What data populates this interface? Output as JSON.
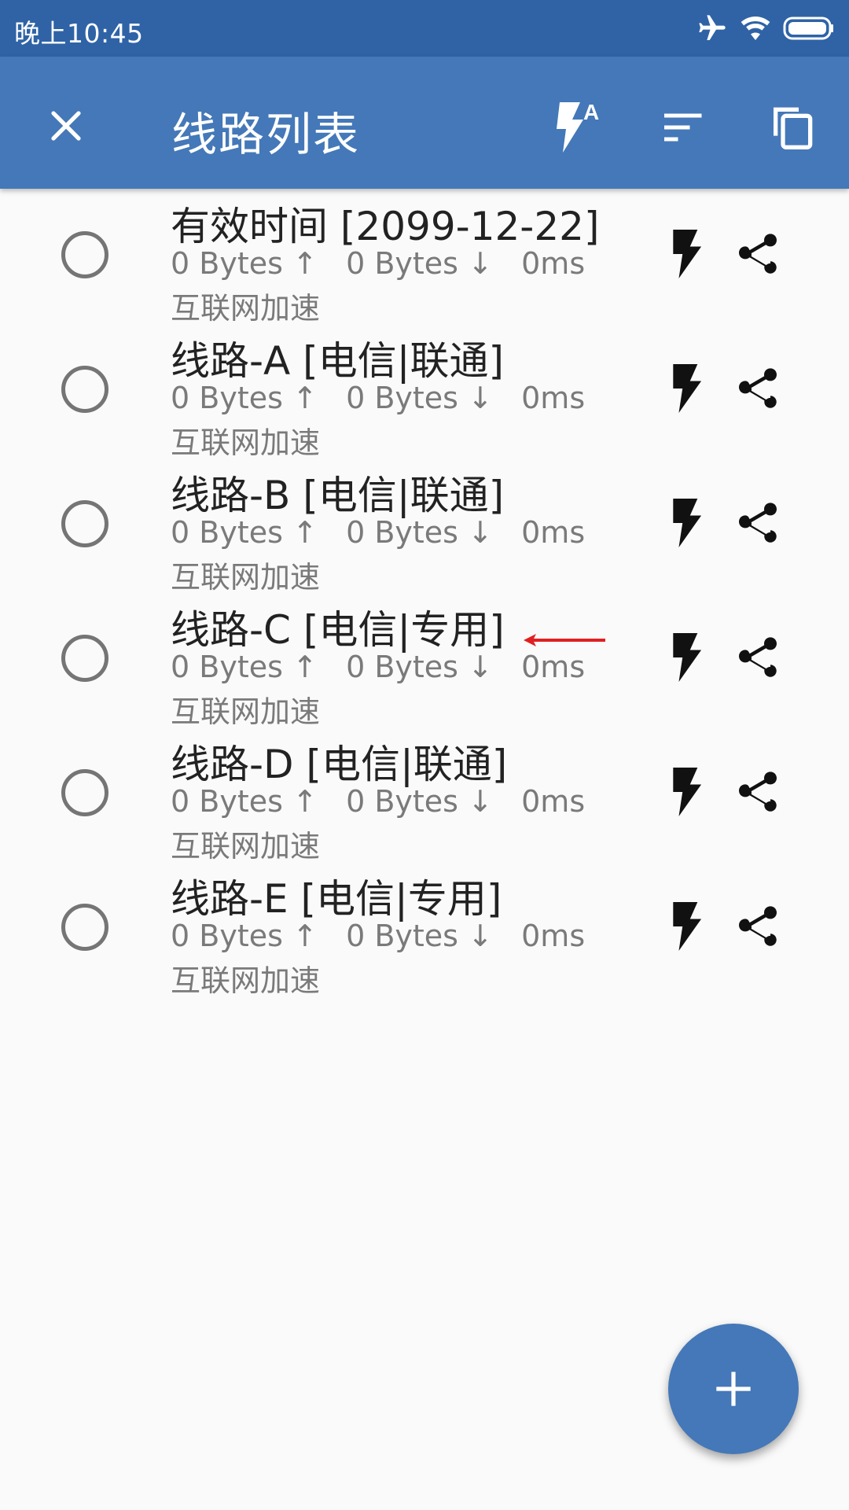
{
  "status_bar": {
    "time": "晚上10:45",
    "icons": [
      "airplane-icon",
      "wifi-icon",
      "battery-icon"
    ]
  },
  "app_bar": {
    "title": "线路列表",
    "icons": [
      "close-icon",
      "auto-boost-icon",
      "sort-icon",
      "copy-icon"
    ],
    "auto_icon_letter": "A",
    "bg_color": "#4478b8",
    "status_color": "#2f63a6"
  },
  "routes": [
    {
      "name": "有效时间 [2099-12-22]",
      "upload": "0 Bytes ↑",
      "download": "0 Bytes ↓",
      "latency": "0ms",
      "description": "互联网加速",
      "selected": false
    },
    {
      "name": "线路-A [电信|联通]",
      "upload": "0 Bytes ↑",
      "download": "0 Bytes ↓",
      "latency": "0ms",
      "description": "互联网加速",
      "selected": false
    },
    {
      "name": "线路-B [电信|联通]",
      "upload": "0 Bytes ↑",
      "download": "0 Bytes ↓",
      "latency": "0ms",
      "description": "互联网加速",
      "selected": false
    },
    {
      "name": "线路-C [电信|专用]",
      "upload": "0 Bytes ↑",
      "download": "0 Bytes ↓",
      "latency": "0ms",
      "description": "互联网加速",
      "selected": false,
      "annotated": true
    },
    {
      "name": "线路-D [电信|联通]",
      "upload": "0 Bytes ↑",
      "download": "0 Bytes ↓",
      "latency": "0ms",
      "description": "互联网加速",
      "selected": false
    },
    {
      "name": "线路-E [电信|专用]",
      "upload": "0 Bytes ↑",
      "download": "0 Bytes ↓",
      "latency": "0ms",
      "description": "互联网加速",
      "selected": false
    }
  ],
  "annotation_color": "#e02020",
  "fab": {
    "icon": "plus-icon"
  }
}
